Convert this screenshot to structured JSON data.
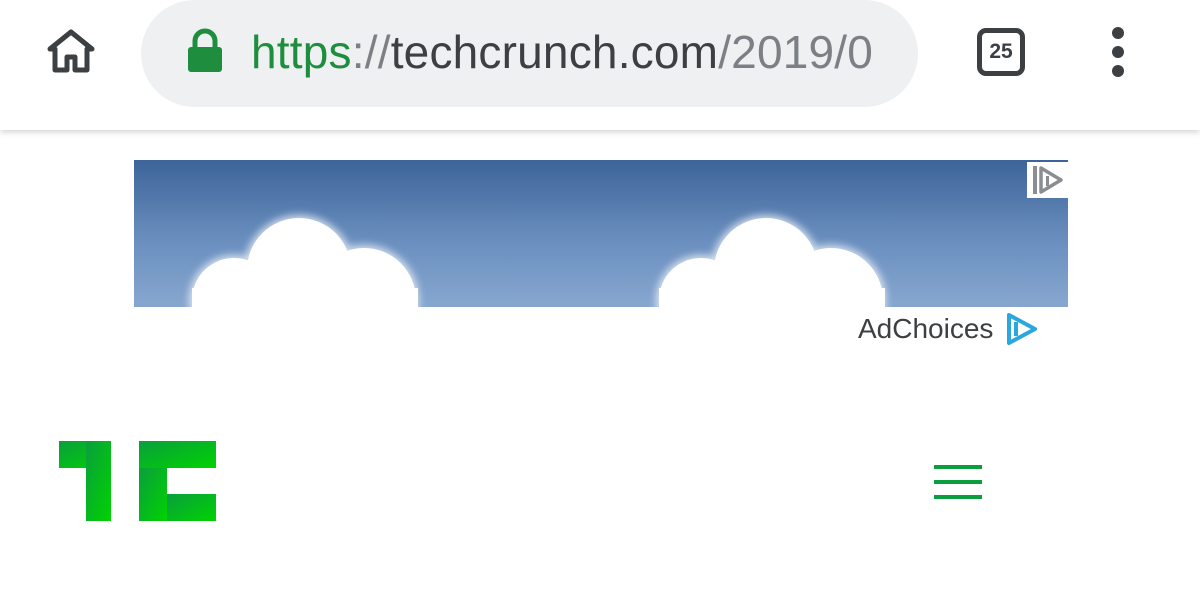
{
  "browser": {
    "address_bar": {
      "url_scheme": "https",
      "url_separator": "://",
      "url_host": "techcrunch.com",
      "url_path": "/2019/0",
      "security": "lock-icon"
    },
    "tab_count": "25",
    "icons": {
      "home": "home-icon",
      "tabs": "tab-switcher-icon",
      "menu": "more-vert-icon"
    }
  },
  "ad": {
    "adchoices_label": "AdChoices",
    "icon": "adchoices-icon"
  },
  "site": {
    "logo": "techcrunch-logo",
    "nav_icon": "hamburger-menu-icon"
  },
  "colors": {
    "url_scheme": "#1e8e3e",
    "url_host": "#3c4043",
    "url_path": "#7c7f84",
    "omnibox_bg": "#eef0f2",
    "brand_green": "#0a9e3c",
    "brand_green_light": "#00d301",
    "ad_sky_top": "#3d6499",
    "ad_sky_bottom": "#87a7cf",
    "adchoices_blue": "#2aa7df"
  }
}
